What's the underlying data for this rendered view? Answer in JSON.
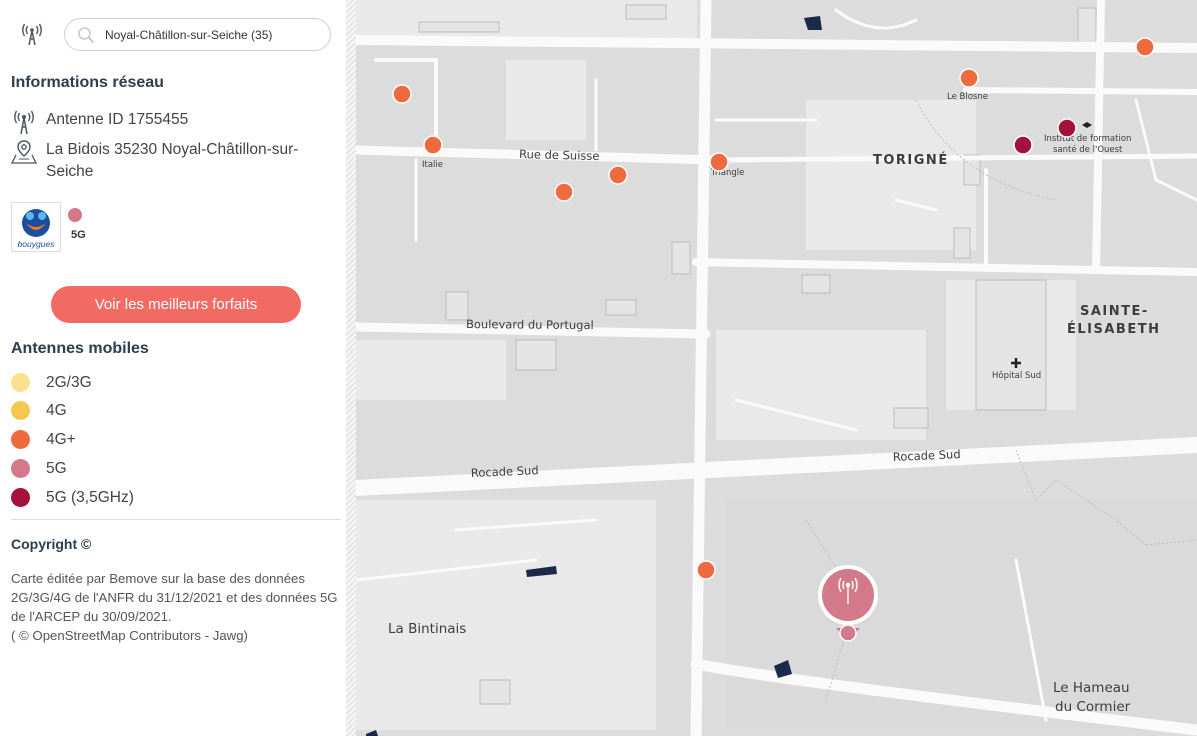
{
  "search": {
    "value": "Noyal-Châtillon-sur-Seiche (35)"
  },
  "info": {
    "title": "Informations réseau",
    "antenna_id": "Antenne ID 1755455",
    "address": "La Bidois 35230 Noyal-Châtillon-sur-Seiche"
  },
  "operator": {
    "tech": "5G",
    "dot_color": "#d4798a"
  },
  "cta": {
    "label": "Voir les meilleurs forfaits"
  },
  "legend": {
    "title": "Antennes mobiles",
    "items": [
      {
        "label": "2G/3G",
        "color": "#fbe08e"
      },
      {
        "label": "4G",
        "color": "#f6c74e"
      },
      {
        "label": "4G+",
        "color": "#ef6a3f"
      },
      {
        "label": "5G",
        "color": "#d4798a"
      },
      {
        "label": "5G (3,5GHz)",
        "color": "#a3123d"
      }
    ]
  },
  "copyright": {
    "title": "Copyright ©",
    "text": "Carte éditée par Bemove sur la base des données 2G/3G/4G de l'ANFR du 31/12/2021 et des données 5G de l'ARCEP du 30/09/2021.",
    "osm": "( © OpenStreetMap Contributors - Jawg)"
  },
  "map": {
    "labels": {
      "rue_suisse": "Rue de Suisse",
      "bd_portugal": "Boulevard du Portugal",
      "rocade_1": "Rocade Sud",
      "rocade_2": "Rocade Sud",
      "torigne": "TORIGNÉ",
      "ste_elisabeth_1": "SAINTE-",
      "ste_elisabeth_2": "ÉLISABETH",
      "hopital": "Hôpital Sud",
      "le_blosne": "Le Blosne",
      "institut_1": "Institut de formation",
      "institut_2": "santé de l'Ouest",
      "italie": "Italie",
      "triangle": "Triangle",
      "bintinais": "La Bintinais",
      "hameau_1": "Le Hameau",
      "hameau_2": "du Cormier"
    },
    "colors": {
      "antenna_4g_plus": "#ef6a3f",
      "antenna_5g_35": "#a3123d",
      "selected": "#d4798a"
    }
  }
}
